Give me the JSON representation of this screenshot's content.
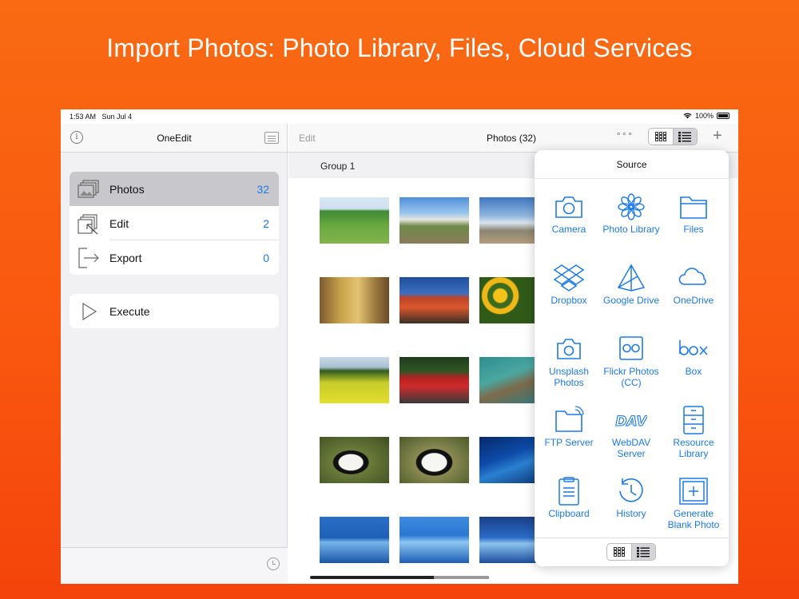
{
  "headline": "Import Photos: Photo Library, Files, Cloud Services",
  "status_bar": {
    "time": "1:53 AM",
    "date": "Sun Jul 4",
    "battery": "100%"
  },
  "sidebar": {
    "title": "OneEdit",
    "items": [
      {
        "label": "Photos",
        "count": "32",
        "icon": "photos-icon"
      },
      {
        "label": "Edit",
        "count": "2",
        "icon": "edit-icon"
      },
      {
        "label": "Export",
        "count": "0",
        "icon": "export-icon"
      }
    ],
    "execute": {
      "label": "Execute",
      "icon": "play-icon"
    }
  },
  "main": {
    "edit_label": "Edit",
    "title": "Photos (32)",
    "more_label": "∘∘∘",
    "plus_label": "+",
    "group_label": "Group 1"
  },
  "popover": {
    "title": "Source",
    "sources": [
      {
        "label": "Camera",
        "icon": "camera-icon"
      },
      {
        "label": "Photo Library",
        "icon": "photo-library-icon"
      },
      {
        "label": "Files",
        "icon": "folder-icon"
      },
      {
        "label": "Dropbox",
        "icon": "dropbox-icon"
      },
      {
        "label": "Google Drive",
        "icon": "google-drive-icon"
      },
      {
        "label": "OneDrive",
        "icon": "onedrive-icon"
      },
      {
        "label": "Unsplash Photos",
        "icon": "unsplash-camera-icon"
      },
      {
        "label": "Flickr Photos (CC)",
        "icon": "flickr-icon"
      },
      {
        "label": "Box",
        "icon": "box-icon"
      },
      {
        "label": "FTP Server",
        "icon": "ftp-folder-icon"
      },
      {
        "label": "WebDAV Server",
        "icon": "webdav-icon"
      },
      {
        "label": "Resource Library",
        "icon": "cabinet-icon"
      },
      {
        "label": "Clipboard",
        "icon": "clipboard-icon"
      },
      {
        "label": "History",
        "icon": "history-icon"
      },
      {
        "label": "Generate Blank Photo",
        "icon": "generate-blank-icon"
      }
    ]
  },
  "colors": {
    "accent": "#1c7ae8",
    "background": "#f9560f"
  }
}
